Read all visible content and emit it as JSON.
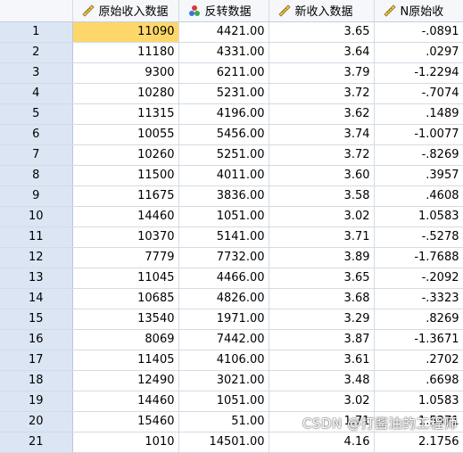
{
  "columns": [
    {
      "label": "原始收入数据",
      "icon": "ruler-scale-icon"
    },
    {
      "label": "反转数据",
      "icon": "nominal-balls-icon"
    },
    {
      "label": "新收入数据",
      "icon": "ruler-scale-icon"
    },
    {
      "label": "N原始收",
      "icon": "ruler-scale-icon"
    }
  ],
  "rows": [
    [
      "1",
      "11090",
      "4421.00",
      "3.65",
      "-.0891"
    ],
    [
      "2",
      "11180",
      "4331.00",
      "3.64",
      ".0297"
    ],
    [
      "3",
      "9300",
      "6211.00",
      "3.79",
      "-1.2294"
    ],
    [
      "4",
      "10280",
      "5231.00",
      "3.72",
      "-.7074"
    ],
    [
      "5",
      "11315",
      "4196.00",
      "3.62",
      ".1489"
    ],
    [
      "6",
      "10055",
      "5456.00",
      "3.74",
      "-1.0077"
    ],
    [
      "7",
      "10260",
      "5251.00",
      "3.72",
      "-.8269"
    ],
    [
      "8",
      "11500",
      "4011.00",
      "3.60",
      ".3957"
    ],
    [
      "9",
      "11675",
      "3836.00",
      "3.58",
      ".4608"
    ],
    [
      "10",
      "14460",
      "1051.00",
      "3.02",
      "1.0583"
    ],
    [
      "11",
      "10370",
      "5141.00",
      "3.71",
      "-.5278"
    ],
    [
      "12",
      "7779",
      "7732.00",
      "3.89",
      "-1.7688"
    ],
    [
      "13",
      "11045",
      "4466.00",
      "3.65",
      "-.2092"
    ],
    [
      "14",
      "10685",
      "4826.00",
      "3.68",
      "-.3323"
    ],
    [
      "15",
      "13540",
      "1971.00",
      "3.29",
      ".8269"
    ],
    [
      "16",
      "8069",
      "7442.00",
      "3.87",
      "-1.3671"
    ],
    [
      "17",
      "11405",
      "4106.00",
      "3.61",
      ".2702"
    ],
    [
      "18",
      "12490",
      "3021.00",
      "3.48",
      ".6698"
    ],
    [
      "19",
      "14460",
      "1051.00",
      "3.02",
      "1.0583"
    ],
    [
      "20",
      "15460",
      "51.00",
      "1.71",
      "1.5371"
    ],
    [
      "21",
      "1010",
      "14501.00",
      "4.16",
      "2.1756"
    ]
  ],
  "selected_cell": {
    "row": 0,
    "col": 1
  },
  "watermark": "CSDN @打酱油的工程师",
  "colors": {
    "row_header_bg": "#dbe5f3",
    "selected_cell_bg": "#fdd76a",
    "grid_line": "#d3dbe6"
  }
}
